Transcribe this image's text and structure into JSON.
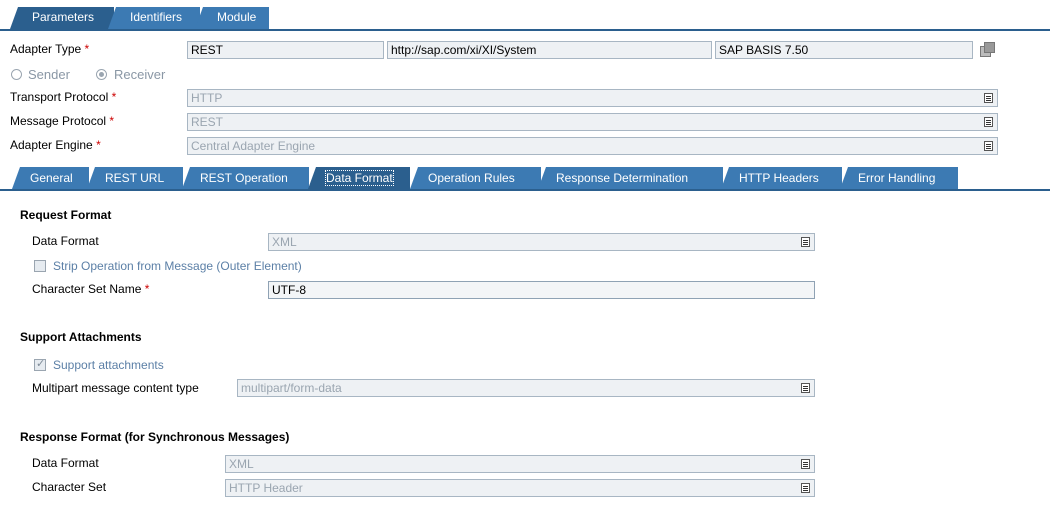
{
  "top_tabs": [
    "Parameters",
    "Identifiers",
    "Module"
  ],
  "adapter": {
    "type_label": "Adapter Type",
    "type_value": "REST",
    "namespace": "http://sap.com/xi/XI/System",
    "software": "SAP BASIS 7.50",
    "sender_label": "Sender",
    "receiver_label": "Receiver",
    "selected_direction": "Receiver",
    "transport_label": "Transport Protocol",
    "transport_value": "HTTP",
    "message_label": "Message Protocol",
    "message_value": "REST",
    "engine_label": "Adapter Engine",
    "engine_value": "Central Adapter Engine",
    "required_marker": "*"
  },
  "sub_tabs": [
    "General",
    "REST URL",
    "REST Operation",
    "Data Format",
    "Operation Rules",
    "Response Determination",
    "HTTP Headers",
    "Error Handling"
  ],
  "active_sub_tab": "Data Format",
  "request_format": {
    "title": "Request Format",
    "data_format_label": "Data Format",
    "data_format_value": "XML",
    "strip_label": "Strip Operation from Message (Outer Element)",
    "strip_checked": false,
    "charset_label": "Character Set Name",
    "charset_value": "UTF-8"
  },
  "attachments": {
    "title": "Support Attachments",
    "support_label": "Support attachments",
    "support_checked": true,
    "multipart_label": "Multipart message content type",
    "multipart_value": "multipart/form-data"
  },
  "response_format": {
    "title": "Response Format (for Synchronous Messages)",
    "data_format_label": "Data Format",
    "data_format_value": "XML",
    "charset_label": "Character Set",
    "charset_value": "HTTP Header"
  }
}
